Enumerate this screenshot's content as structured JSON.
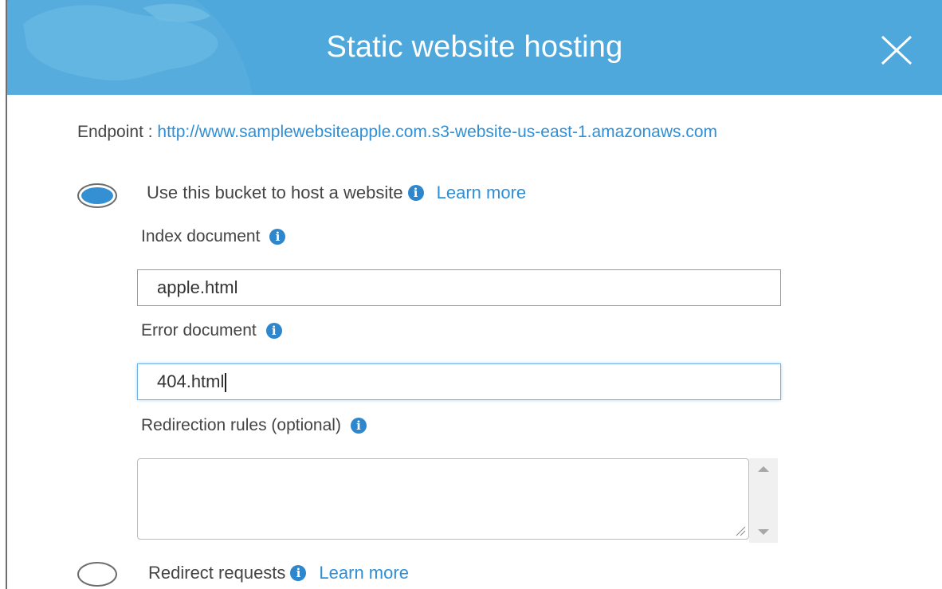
{
  "dialog": {
    "title": "Static website hosting",
    "colors": {
      "header": "#4ea8dc",
      "link": "#2e8fd6",
      "radio_selected": "#3590d3"
    }
  },
  "endpoint": {
    "label": "Endpoint : ",
    "url": "http://www.samplewebsiteapple.com.s3-website-us-east-1.amazonaws.com"
  },
  "options": [
    {
      "label": "Use this bucket to host a website",
      "learn_more": "Learn more",
      "selected": true
    },
    {
      "label": "Redirect requests",
      "learn_more": "Learn more",
      "selected": false
    }
  ],
  "fields": {
    "index_document": {
      "label": "Index document",
      "value": "apple.html"
    },
    "error_document": {
      "label": "Error document",
      "value": "404.html"
    },
    "redirection_rules": {
      "label": "Redirection rules (optional)",
      "value": ""
    }
  },
  "icons": {
    "close": "close-icon",
    "info": "info-icon"
  }
}
